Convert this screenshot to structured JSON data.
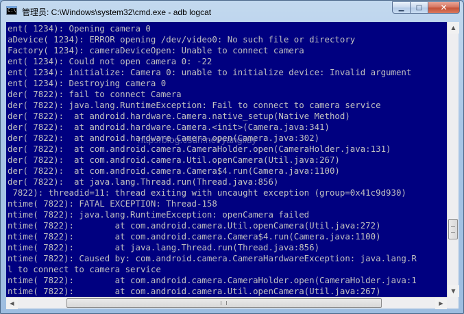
{
  "window": {
    "title": "管理员: C:\\Windows\\system32\\cmd.exe - adb  logcat",
    "minimize_glyph": "▁",
    "maximize_glyph": "□",
    "close_glyph": "✕"
  },
  "console": {
    "background": "#000080",
    "text_color": "#c0c0c0",
    "lines": [
      "ent( 1234): Opening camera 0",
      "aDevice( 1234): ERROR opening /dev/video0: No such file or directory",
      "Factory( 1234): cameraDeviceOpen: Unable to connect camera",
      "ent( 1234): Could not open camera 0: -22",
      "ent( 1234): initialize: Camera 0: unable to initialize device: Invalid argument",
      "ent( 1234): Destroying camera 0",
      "der( 7822): fail to connect Camera",
      "der( 7822): java.lang.RuntimeException: Fail to connect to camera service",
      "der( 7822):  at android.hardware.Camera.native_setup(Native Method)",
      "der( 7822):  at android.hardware.Camera.<init>(Camera.java:341)",
      "der( 7822):  at android.hardware.Camera.open(Camera.java:302)",
      "der( 7822):  at com.android.camera.CameraHolder.open(CameraHolder.java:131)",
      "der( 7822):  at com.android.camera.Util.openCamera(Util.java:267)",
      "der( 7822):  at com.android.camera.Camera$4.run(Camera.java:1100)",
      "der( 7822):  at java.lang.Thread.run(Thread.java:856)",
      " 7822): threadid=11: thread exiting with uncaught exception (group=0x41c9d930)",
      "ntime( 7822): FATAL EXCEPTION: Thread-158",
      "ntime( 7822): java.lang.RuntimeException: openCamera failed",
      "ntime( 7822):        at com.android.camera.Util.openCamera(Util.java:272)",
      "ntime( 7822):        at com.android.camera.Camera$4.run(Camera.java:1100)",
      "ntime( 7822):        at java.lang.Thread.run(Thread.java:856)",
      "ntime( 7822): Caused by: com.android.camera.CameraHardwareException: java.lang.R",
      "l to connect to camera service",
      "ntime( 7822):        at com.android.camera.CameraHolder.open(CameraHolder.java:1",
      "ntime( 7822):        at com.android.camera.Util.openCamera(Util.java:267)"
    ]
  },
  "watermark": "http://blog.csdn.net/yangliuy",
  "scrollbars": {
    "up_arrow": "▲",
    "down_arrow": "▼",
    "left_arrow": "◀",
    "right_arrow": "▶"
  }
}
